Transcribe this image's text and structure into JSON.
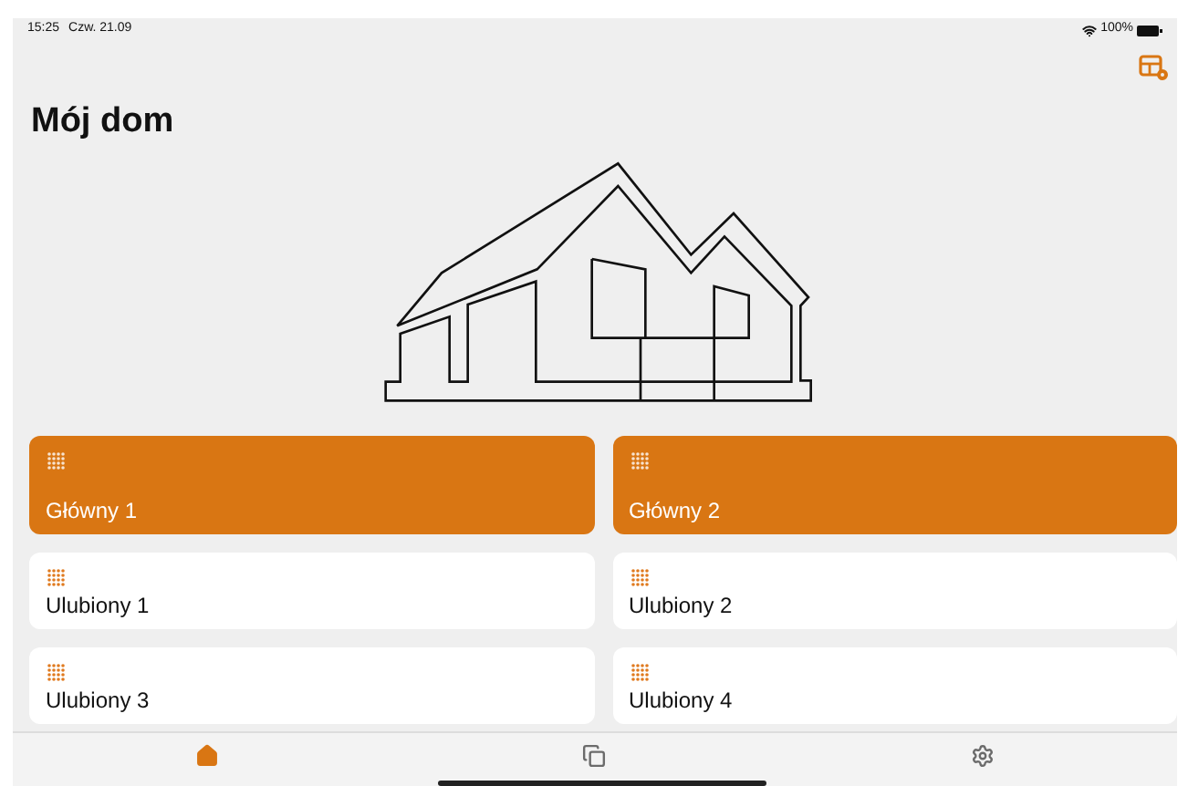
{
  "status_bar": {
    "time": "15:25",
    "date": "Czw. 21.09",
    "battery": "100%"
  },
  "title": "Mój dom",
  "tiles": [
    {
      "label": "Główny 1",
      "kind": "main"
    },
    {
      "label": "Główny 2",
      "kind": "main"
    },
    {
      "label": "Ulubiony 1",
      "kind": "favorite"
    },
    {
      "label": "Ulubiony 2",
      "kind": "favorite"
    },
    {
      "label": "Ulubiony 3",
      "kind": "favorite"
    },
    {
      "label": "Ulubiony 4",
      "kind": "favorite"
    }
  ],
  "tab_bar": [
    {
      "kind": "home",
      "selected": true
    },
    {
      "kind": "copies",
      "selected": false
    },
    {
      "kind": "settings",
      "selected": false
    }
  ]
}
